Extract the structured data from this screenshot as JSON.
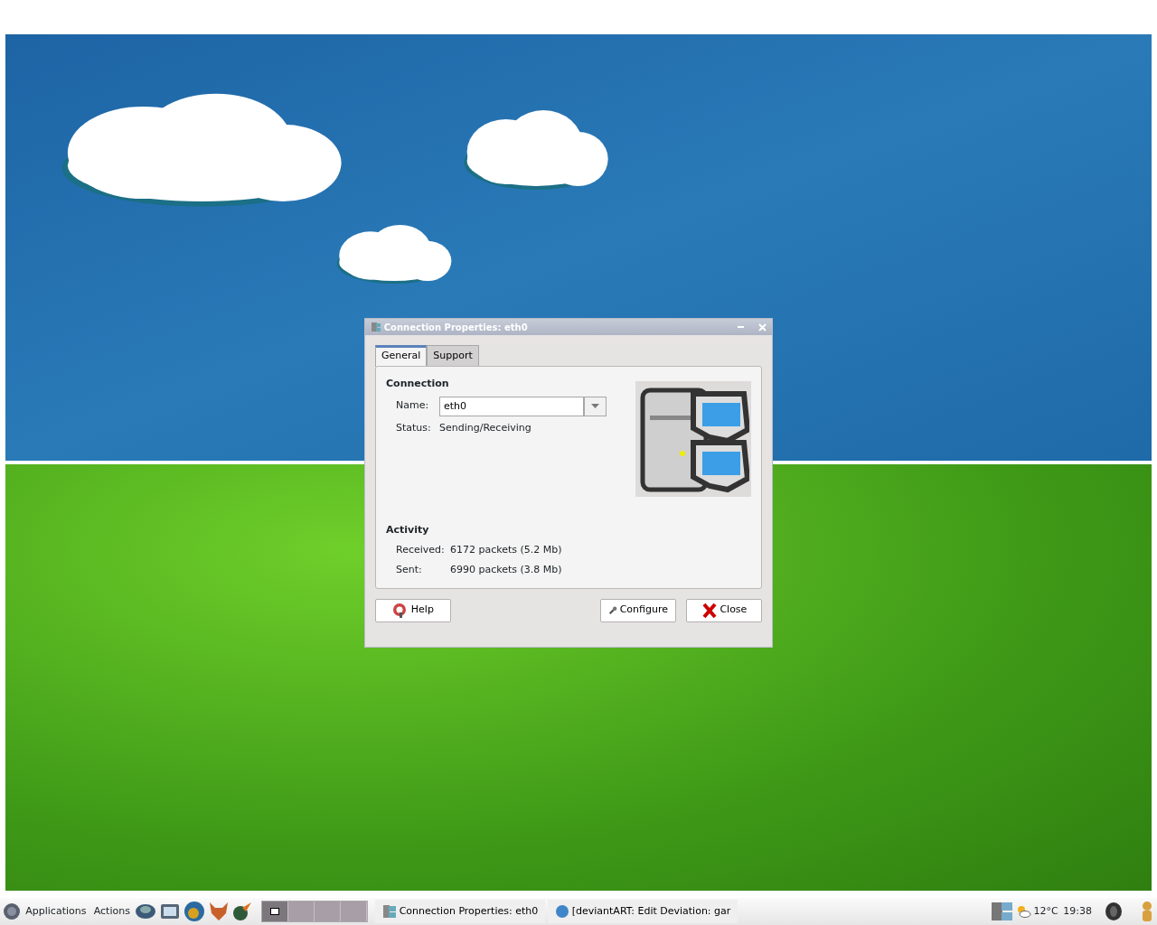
{
  "dialog": {
    "title": "Connection Properties: eth0",
    "tabs": [
      {
        "label": "General",
        "selected": true
      },
      {
        "label": "Support",
        "selected": false
      }
    ],
    "connection": {
      "heading": "Connection",
      "name_label": "Name:",
      "name_value": "eth0",
      "status_label": "Status:",
      "status_value": "Sending/Receiving"
    },
    "activity": {
      "heading": "Activity",
      "rows": [
        {
          "label": "Received:",
          "value": "6172 packets (5.2 Mb)"
        },
        {
          "label": "Sent:",
          "value": "6990 packets (3.8 Mb)"
        }
      ]
    },
    "buttons": [
      {
        "label": "Help",
        "kind": "help"
      },
      {
        "label": "Configure",
        "kind": "configure"
      },
      {
        "label": "Close",
        "kind": "close"
      }
    ]
  },
  "taskbar": {
    "menus": [
      "Applications",
      "Actions"
    ],
    "workspaces": [
      {
        "selected": true
      },
      {
        "selected": false
      },
      {
        "selected": false
      },
      {
        "selected": false
      }
    ],
    "tasks": [
      {
        "label": "Connection Properties: eth0",
        "kind": "network"
      },
      {
        "label": "[deviantART: Edit Deviation: gar",
        "kind": "browser"
      }
    ],
    "temperature": "12°C",
    "clock": "19:38"
  }
}
